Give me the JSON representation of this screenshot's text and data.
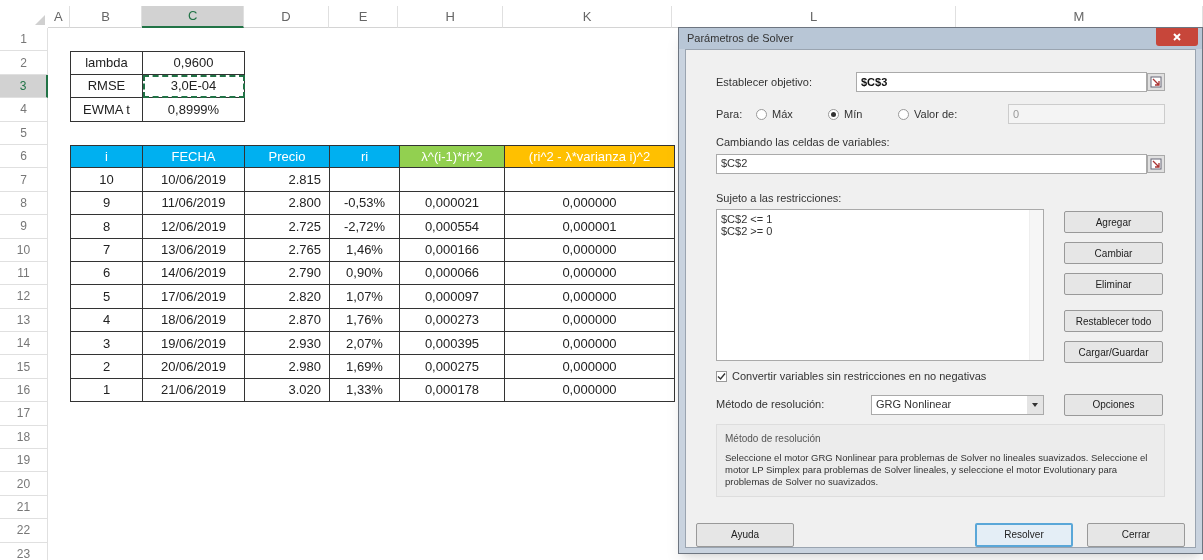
{
  "sheet": {
    "columns": [
      {
        "label": "A",
        "selected": false
      },
      {
        "label": "B",
        "selected": false
      },
      {
        "label": "C",
        "selected": true
      },
      {
        "label": "D",
        "selected": false
      },
      {
        "label": "E",
        "selected": false
      },
      {
        "label": "H",
        "selected": false
      },
      {
        "label": "K",
        "selected": false
      },
      {
        "label": "L",
        "selected": false
      },
      {
        "label": "M",
        "selected": false
      }
    ],
    "rows": [
      {
        "number": "1",
        "selected": false
      },
      {
        "number": "2",
        "selected": false
      },
      {
        "number": "3",
        "selected": true
      },
      {
        "number": "4",
        "selected": false
      },
      {
        "number": "5",
        "selected": false
      },
      {
        "number": "6",
        "selected": false
      },
      {
        "number": "7",
        "selected": false
      },
      {
        "number": "8",
        "selected": false
      },
      {
        "number": "9",
        "selected": false
      },
      {
        "number": "10",
        "selected": false
      },
      {
        "number": "11",
        "selected": false
      },
      {
        "number": "12",
        "selected": false
      },
      {
        "number": "13",
        "selected": false
      },
      {
        "number": "14",
        "selected": false
      },
      {
        "number": "15",
        "selected": false
      },
      {
        "number": "16",
        "selected": false
      },
      {
        "number": "17",
        "selected": false
      },
      {
        "number": "18",
        "selected": false
      },
      {
        "number": "19",
        "selected": false
      },
      {
        "number": "20",
        "selected": false
      },
      {
        "number": "21",
        "selected": false
      },
      {
        "number": "22",
        "selected": false
      },
      {
        "number": "23",
        "selected": false
      }
    ],
    "params": [
      {
        "label": "lambda",
        "value": "0,9600",
        "marquee": false
      },
      {
        "label": "RMSE",
        "value": "3,0E-04",
        "marquee": true
      },
      {
        "label": "EWMA t",
        "value": "0,8999%",
        "marquee": false
      }
    ],
    "table": {
      "columns": [
        {
          "label": "i",
          "color": "#00b0f0"
        },
        {
          "label": "FECHA",
          "color": "#00b0f0"
        },
        {
          "label": "Precio",
          "color": "#00b0f0"
        },
        {
          "label": "ri",
          "color": "#00b0f0"
        },
        {
          "label": "λ^(i-1)*ri^2",
          "color": "#92d050"
        },
        {
          "label": "(ri^2 - λ*varianza i)^2",
          "color": "#ffc000"
        }
      ],
      "rows": [
        [
          "10",
          "10/06/2019",
          "2.815",
          "",
          "",
          ""
        ],
        [
          "9",
          "11/06/2019",
          "2.800",
          "-0,53%",
          "0,000021",
          "0,000000"
        ],
        [
          "8",
          "12/06/2019",
          "2.725",
          "-2,72%",
          "0,000554",
          "0,000001"
        ],
        [
          "7",
          "13/06/2019",
          "2.765",
          "1,46%",
          "0,000166",
          "0,000000"
        ],
        [
          "6",
          "14/06/2019",
          "2.790",
          "0,90%",
          "0,000066",
          "0,000000"
        ],
        [
          "5",
          "17/06/2019",
          "2.820",
          "1,07%",
          "0,000097",
          "0,000000"
        ],
        [
          "4",
          "18/06/2019",
          "2.870",
          "1,76%",
          "0,000273",
          "0,000000"
        ],
        [
          "3",
          "19/06/2019",
          "2.930",
          "2,07%",
          "0,000395",
          "0,000000"
        ],
        [
          "2",
          "20/06/2019",
          "2.980",
          "1,69%",
          "0,000275",
          "0,000000"
        ],
        [
          "1",
          "21/06/2019",
          "3.020",
          "1,33%",
          "0,000178",
          "0,000000"
        ]
      ]
    }
  },
  "dialog": {
    "title": "Parámetros de Solver",
    "objective": {
      "label": "Establecer objetivo:",
      "value": "$C$3"
    },
    "to": {
      "label": "Para:",
      "options": [
        {
          "label": "Máx",
          "selected": false
        },
        {
          "label": "Mín",
          "selected": true
        },
        {
          "label": "Valor de:",
          "selected": false
        }
      ],
      "value": "0"
    },
    "changing": {
      "label": "Cambiando las celdas de variables:",
      "value": "$C$2"
    },
    "constraints": {
      "label": "Sujeto a las restricciones:",
      "items": [
        "$C$2 <= 1",
        "$C$2 >= 0"
      ]
    },
    "side_buttons": [
      "Agregar",
      "Cambiar",
      "Eliminar",
      "Restablecer todo",
      "Cargar/Guardar"
    ],
    "nonnegative": {
      "label": "Convertir variables sin restricciones en no negativas",
      "checked": true
    },
    "method": {
      "label": "Método de resolución:",
      "value": "GRG Nonlinear",
      "button": "Opciones"
    },
    "method_group": {
      "title": "Método de resolución",
      "text": "Seleccione el motor GRG Nonlinear para problemas de Solver no lineales suavizados. Seleccione el motor LP Simplex para problemas de Solver lineales, y seleccione el motor Evolutionary para problemas de Solver no suavizados."
    },
    "footer_buttons": [
      {
        "label": "Ayuda",
        "default": false
      },
      {
        "label": "Resolver",
        "default": true
      },
      {
        "label": "Cerrar",
        "default": false
      }
    ]
  }
}
